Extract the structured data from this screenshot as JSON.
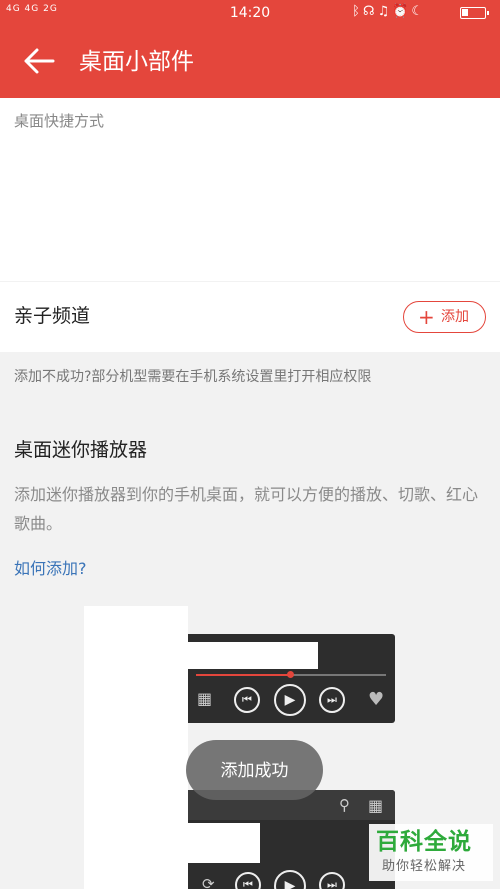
{
  "status_bar": {
    "signal": "4G 4G 2G",
    "time": "14:20",
    "icons": [
      "bluetooth-icon",
      "headset-icon",
      "bell-off-icon",
      "alarm-icon",
      "moon-icon",
      "battery-icon"
    ]
  },
  "app_bar": {
    "title": "桌面小部件",
    "background": "#e4463c"
  },
  "shortcut_section": {
    "label": "桌面快捷方式"
  },
  "channel_row": {
    "label": "亲子频道",
    "add_button_label": "添加"
  },
  "fail_note": "添加不成功?部分机型需要在手机系统设置里打开相应权限",
  "mini_player": {
    "title": "桌面迷你播放器",
    "description": "添加迷你播放器到你的手机桌面，就可以方便的播放、切歌、红心歌曲。",
    "how_link": "如何添加?",
    "progress": 0.5
  },
  "toast": "添加成功",
  "watermark": {
    "main": "百科全说",
    "sub": "助你轻松解决"
  },
  "colors": {
    "accent": "#e4463c",
    "link": "#3a74b8",
    "watermark": "#2eaa3b"
  }
}
